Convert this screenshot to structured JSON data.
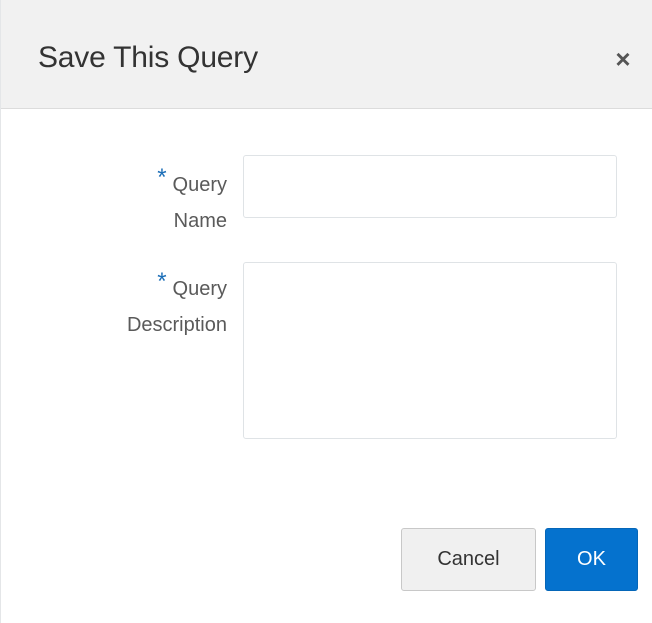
{
  "dialog": {
    "title": "Save This Query",
    "close_symbol": "×",
    "close_icon": "close-icon"
  },
  "form": {
    "required_marker": "*",
    "query_name": {
      "label_line1": "Query",
      "label_line2": "Name",
      "value": "",
      "placeholder": ""
    },
    "query_description": {
      "label_line1": "Query",
      "label_line2": "Description",
      "value": "",
      "placeholder": ""
    }
  },
  "buttons": {
    "cancel_label": "Cancel",
    "ok_label": "OK"
  },
  "colors": {
    "accent": "#0572ce",
    "required": "#1d6fb8",
    "header_bg": "#f1f1f1"
  }
}
